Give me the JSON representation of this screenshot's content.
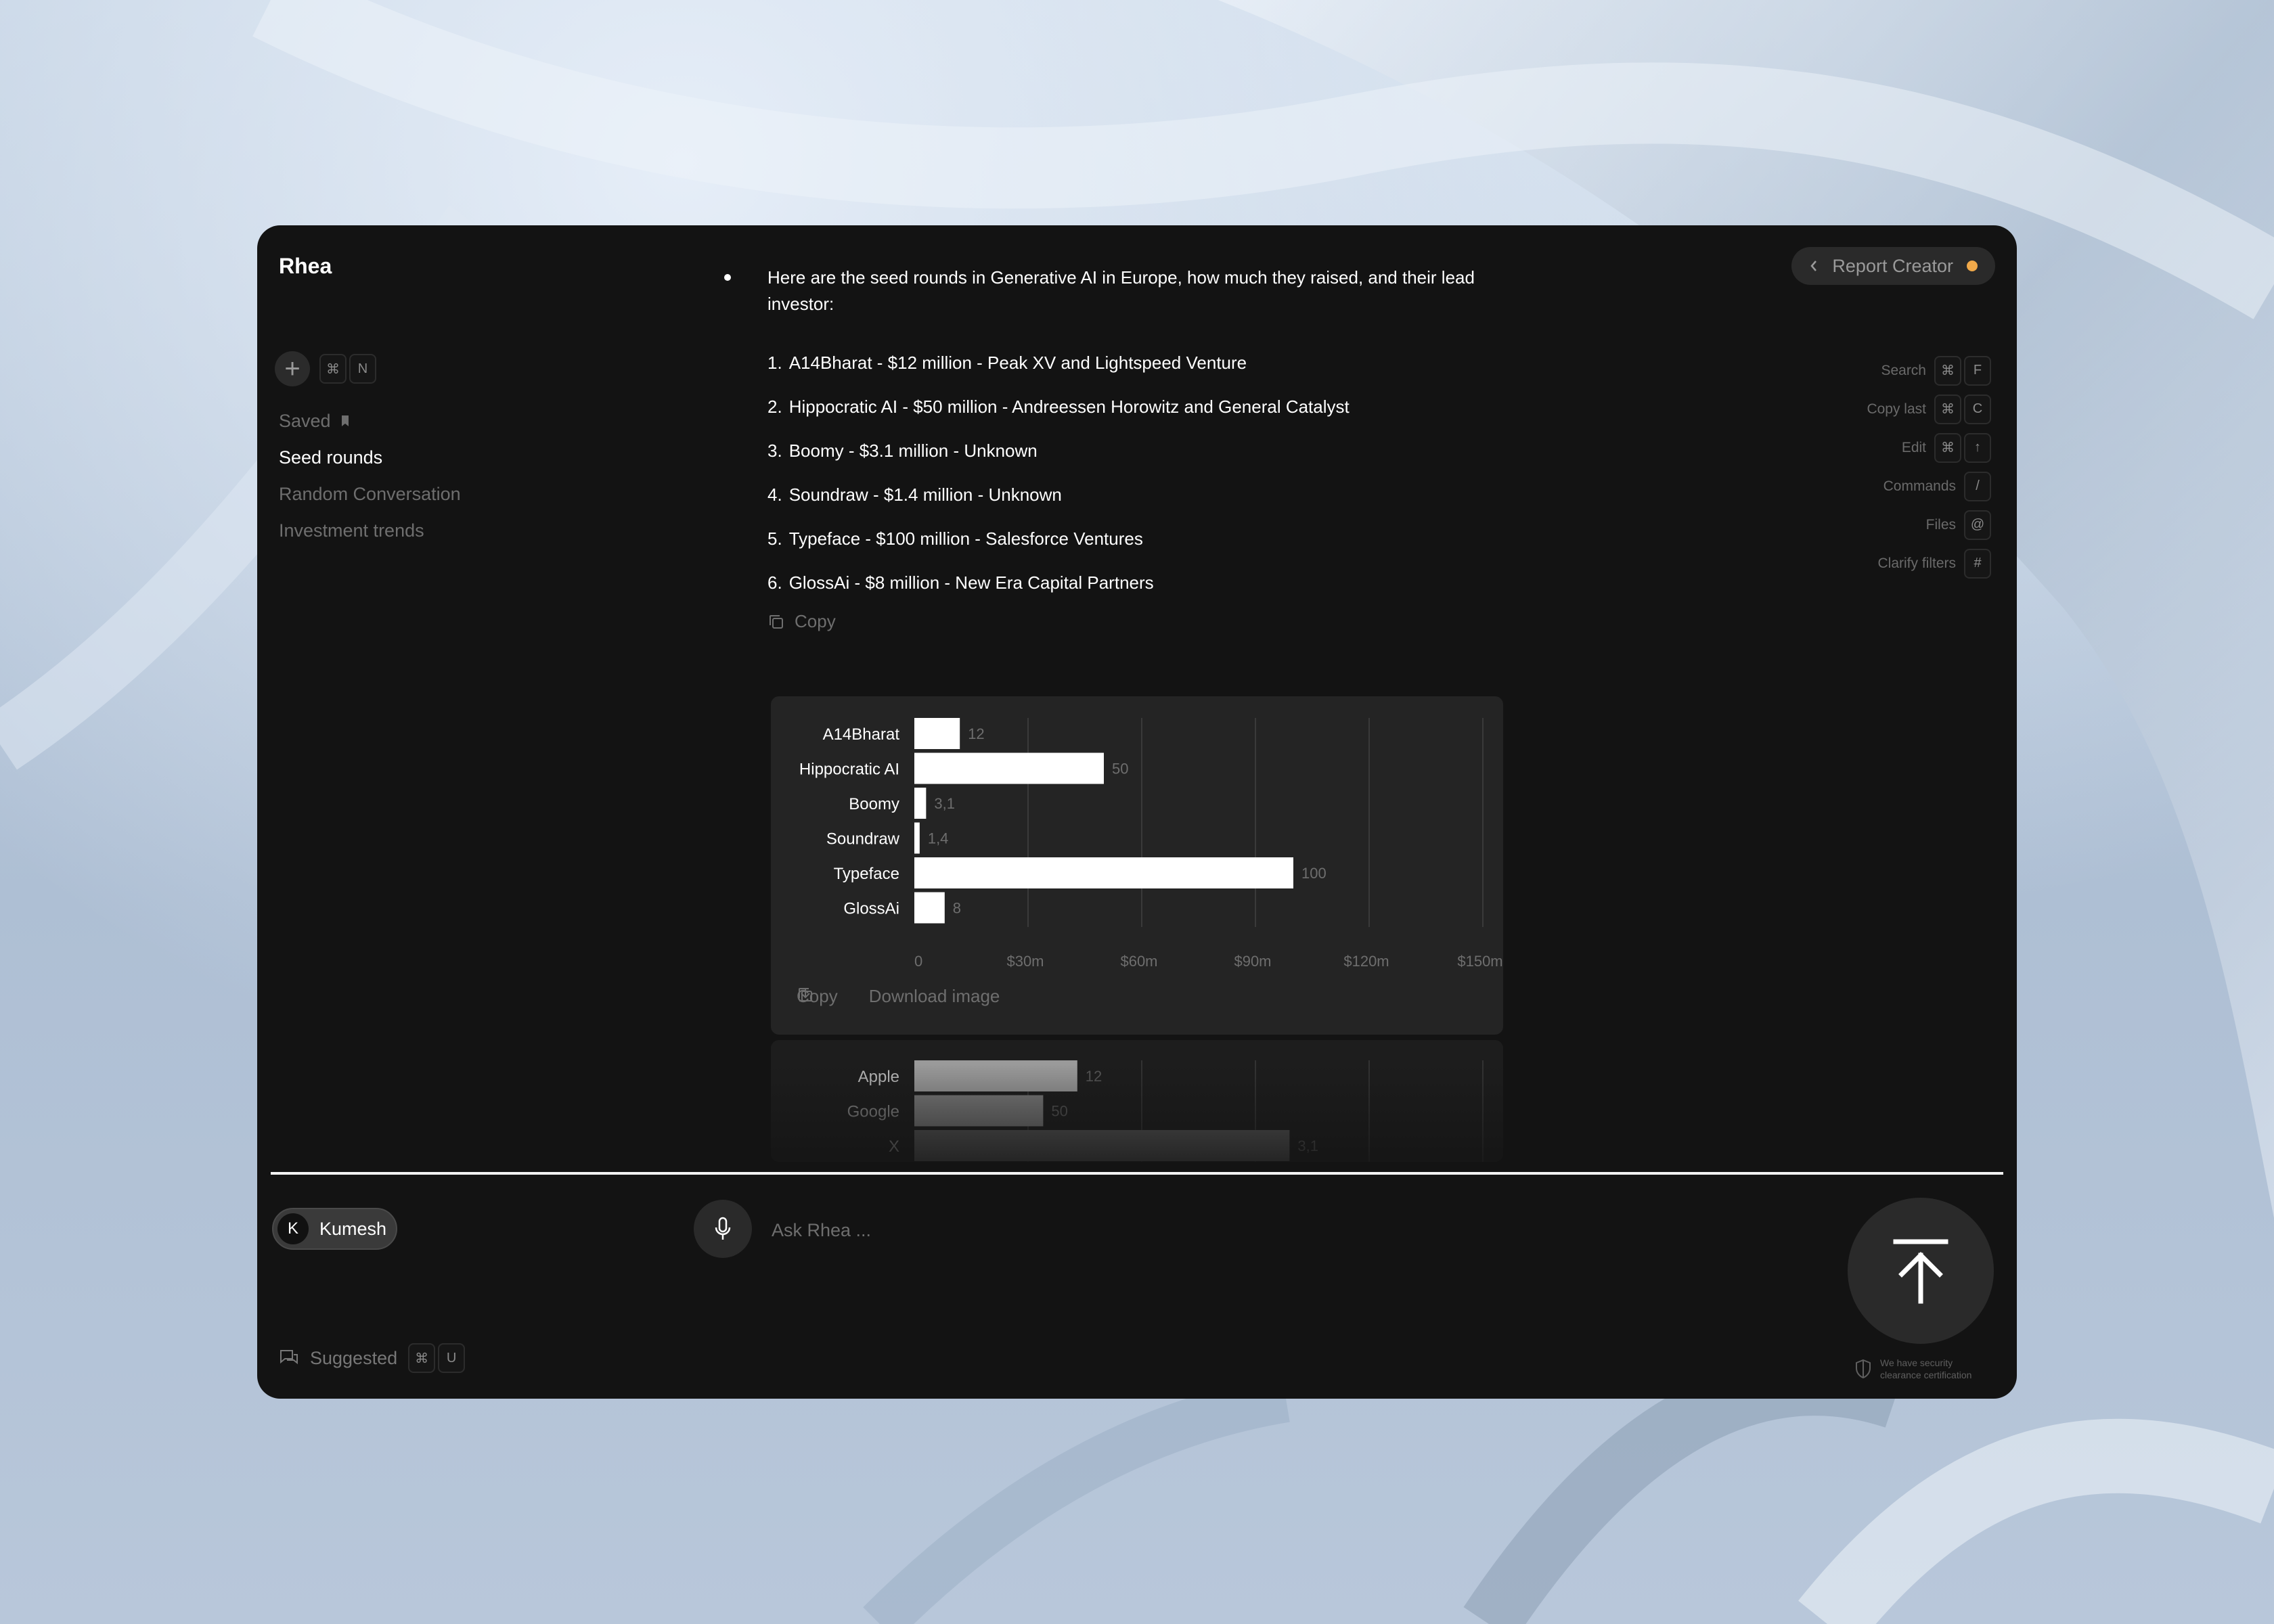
{
  "app": {
    "name": "Rhea"
  },
  "new_chat": {
    "shortcut": [
      "⌘",
      "N"
    ]
  },
  "sidebar": {
    "saved_label": "Saved",
    "items": [
      {
        "label": "Seed rounds",
        "active": true
      },
      {
        "label": "Random Conversation",
        "active": false
      },
      {
        "label": "Investment trends",
        "active": false
      }
    ]
  },
  "header": {
    "report_button": "Report Creator",
    "status_color": "#f0a94a"
  },
  "shortcuts": [
    {
      "label": "Search",
      "keys": [
        "⌘",
        "F"
      ]
    },
    {
      "label": "Copy last",
      "keys": [
        "⌘",
        "C"
      ]
    },
    {
      "label": "Edit",
      "keys": [
        "⌘",
        "↑"
      ]
    },
    {
      "label": "Commands",
      "keys": [
        "/"
      ]
    },
    {
      "label": "Files",
      "keys": [
        "@"
      ]
    },
    {
      "label": "Clarify filters",
      "keys": [
        "#"
      ]
    }
  ],
  "answer": {
    "intro": "Here are the seed rounds in Generative AI in Europe, how much they raised, and their lead investor:",
    "items": [
      {
        "num": "1.",
        "text": "A14Bharat - $12 million - Peak XV and Lightspeed Venture"
      },
      {
        "num": "2.",
        "text": "Hippocratic AI - $50 million - Andreessen Horowitz and General Catalyst"
      },
      {
        "num": "3.",
        "text": "Boomy - $3.1 million - Unknown"
      },
      {
        "num": "4.",
        "text": "Soundraw - $1.4 million - Unknown"
      },
      {
        "num": "5.",
        "text": "Typeface - $100 million - Salesforce Ventures"
      },
      {
        "num": "6.",
        "text": "GlossAi - $8 million - New Era Capital Partners"
      }
    ],
    "copy_label": "Copy"
  },
  "chart_actions": {
    "copy": "Copy",
    "download": "Download image"
  },
  "chart_data": [
    {
      "type": "bar",
      "orientation": "horizontal",
      "categories": [
        "A14Bharat",
        "Hippocratic AI",
        "Boomy",
        "Soundraw",
        "Typeface",
        "GlossAi"
      ],
      "values": [
        12,
        50,
        3.1,
        1.4,
        100,
        8
      ],
      "value_labels": [
        "12",
        "50",
        "3,1",
        "1,4",
        "100",
        "8"
      ],
      "x_ticks": [
        "0",
        "$30m",
        "$60m",
        "$90m",
        "$120m",
        "$150m"
      ],
      "xlim": [
        0,
        150
      ],
      "grid": true,
      "bar_color": "#ffffff"
    },
    {
      "type": "bar",
      "orientation": "horizontal",
      "categories": [
        "Apple",
        "Google",
        "X"
      ],
      "values": [
        43,
        34,
        99
      ],
      "value_labels": [
        "12",
        "50",
        "3,1"
      ],
      "xlim": [
        0,
        150
      ],
      "grid": true,
      "partially_visible": true
    }
  ],
  "user": {
    "initial": "K",
    "name": "Kumesh"
  },
  "composer": {
    "placeholder": "Ask Rhea ..."
  },
  "suggested": {
    "label": "Suggested",
    "keys": [
      "⌘",
      "U"
    ]
  },
  "security_note": {
    "line1": "We have security",
    "line2": "clearance certification"
  }
}
